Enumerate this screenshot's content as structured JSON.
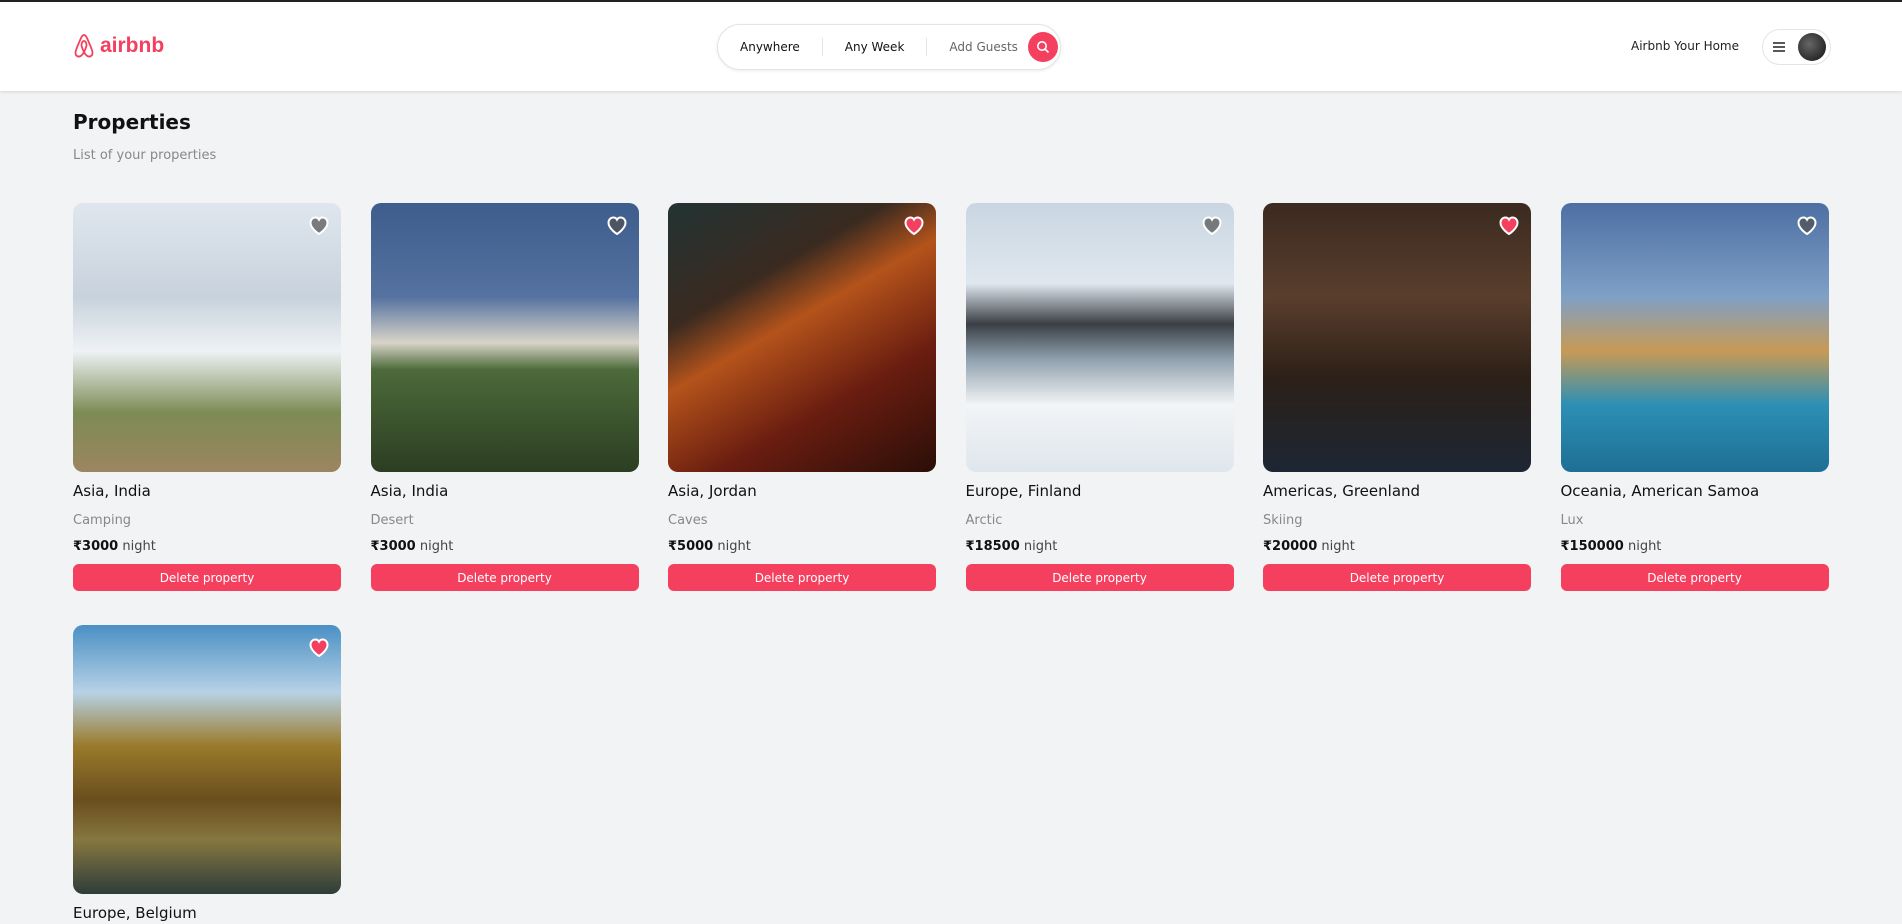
{
  "brand": {
    "name": "airbnb",
    "color": "#f43f5e"
  },
  "search": {
    "location": "Anywhere",
    "week": "Any Week",
    "guests": "Add Guests"
  },
  "nav": {
    "host_label": "Airbnb Your Home"
  },
  "page": {
    "title": "Properties",
    "subtitle": "List of your properties"
  },
  "delete_label": "Delete property",
  "night_label": "night",
  "properties": [
    {
      "location": "Asia, India",
      "category": "Camping",
      "price": "₹3000",
      "favorite": false,
      "image": "linear-gradient(180deg,#dfe6ee 0%,#c8d2dc 35%,#eef2f5 55%,#7d8b55 78%,#9c8560 100%)"
    },
    {
      "location": "Asia, India",
      "category": "Desert",
      "price": "₹3000",
      "favorite": false,
      "image": "linear-gradient(180deg,#3d5d8c 0%,#5572a0 35%,#d8d4c8 52%,#4c6a3a 62%,#2c3e22 100%)"
    },
    {
      "location": "Asia, Jordan",
      "category": "Caves",
      "price": "₹5000",
      "favorite": true,
      "image": "linear-gradient(150deg,#233 0%,#3a2a20 30%,#b4531b 45%,#6a1d10 70%,#2a0e08 100%)"
    },
    {
      "location": "Europe, Finland",
      "category": "Arctic",
      "price": "₹18500",
      "favorite": false,
      "image": "linear-gradient(180deg,#c9d6e2 0%,#dfe7ee 30%,#3a3f45 45%,#8fa0ad 58%,#f2f4f6 75%,#dfe6ec 100%)"
    },
    {
      "location": "Americas, Greenland",
      "category": "Skiing",
      "price": "₹20000",
      "favorite": true,
      "image": "linear-gradient(180deg,#3b2a20 0%,#5a3e2c 35%,#2c2018 65%,#1c2634 100%)"
    },
    {
      "location": "Oceania, American Samoa",
      "category": "Lux",
      "price": "₹150000",
      "favorite": false,
      "image": "linear-gradient(180deg,#4d6fa3 0%,#7fa0c6 35%,#c79a55 55%,#2d8fb5 75%,#1e6f95 100%)"
    },
    {
      "location": "Europe, Belgium",
      "favorite": true,
      "image": "linear-gradient(180deg,#4a8fc4 0%,#b7d2e6 25%,#9a7a2a 45%,#6a4e1e 65%,#86773f 80%,#2e3d3a 100%)"
    }
  ]
}
